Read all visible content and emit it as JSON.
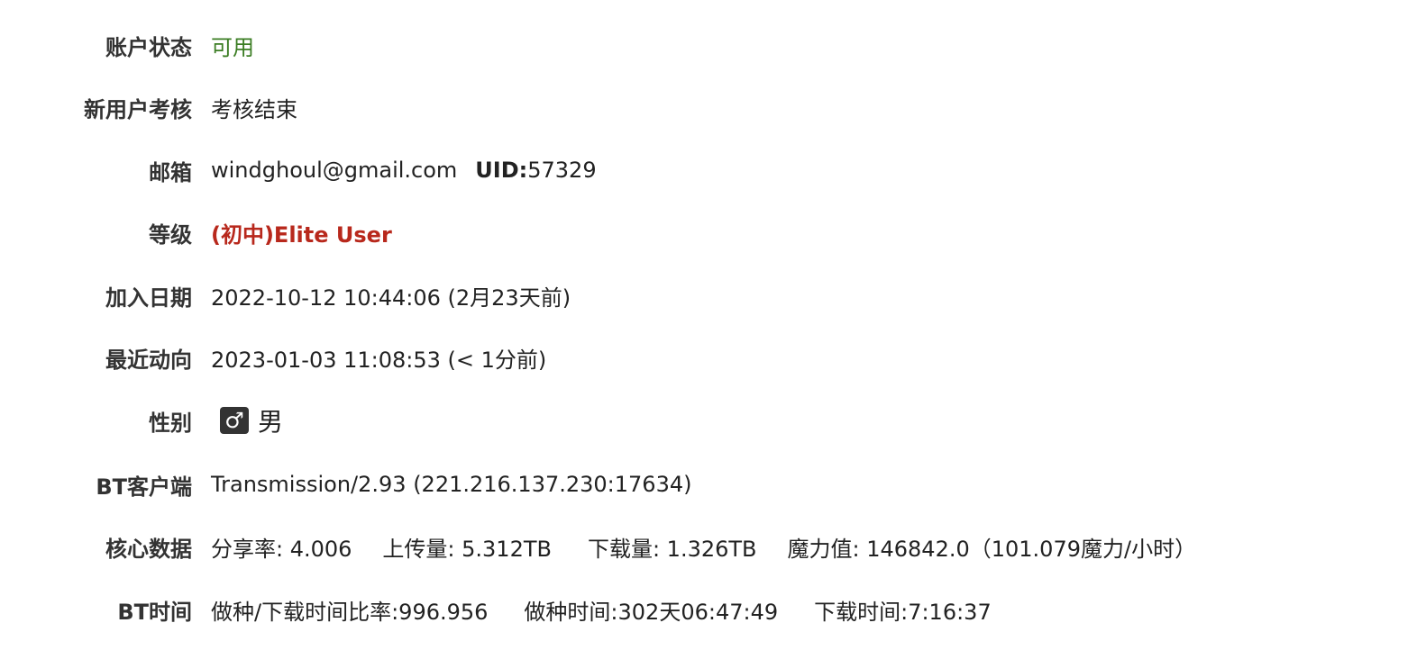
{
  "rows": {
    "account_status": {
      "label": "账户状态",
      "value": "可用"
    },
    "new_user_exam": {
      "label": "新用户考核",
      "value": "考核结束"
    },
    "email": {
      "label": "邮箱",
      "value": "windghoul@gmail.com",
      "uid_label": "UID:",
      "uid_value": "57329"
    },
    "class": {
      "label": "等级",
      "value": "(初中)Elite User"
    },
    "join_date": {
      "label": "加入日期",
      "value": "2022-10-12 10:44:06 (2月23天前)"
    },
    "last_action": {
      "label": "最近动向",
      "value": "2023-01-03 11:08:53 (< 1分前)"
    },
    "gender": {
      "label": "性别",
      "icon": "male-symbol-icon",
      "icon_glyph": "♂",
      "value": "男"
    },
    "bt_client": {
      "label": "BT客户端",
      "value": "Transmission/2.93 (221.216.137.230:17634)"
    },
    "core_data": {
      "label": "核心数据",
      "ratio": "分享率: 4.006",
      "uploaded": "上传量: 5.312TB",
      "downloaded": "下载量: 1.326TB",
      "bonus": "魔力值: 146842.0（101.079魔力/小时）"
    },
    "bt_time": {
      "label": "BT时间",
      "seed_ratio": "做种/下载时间比率:996.956",
      "seed_time": "做种时间:302天06:47:49",
      "leech_time": "下载时间:7:16:37"
    }
  },
  "colors": {
    "status_ok": "#3b7d23",
    "class_color": "#b8281c"
  }
}
